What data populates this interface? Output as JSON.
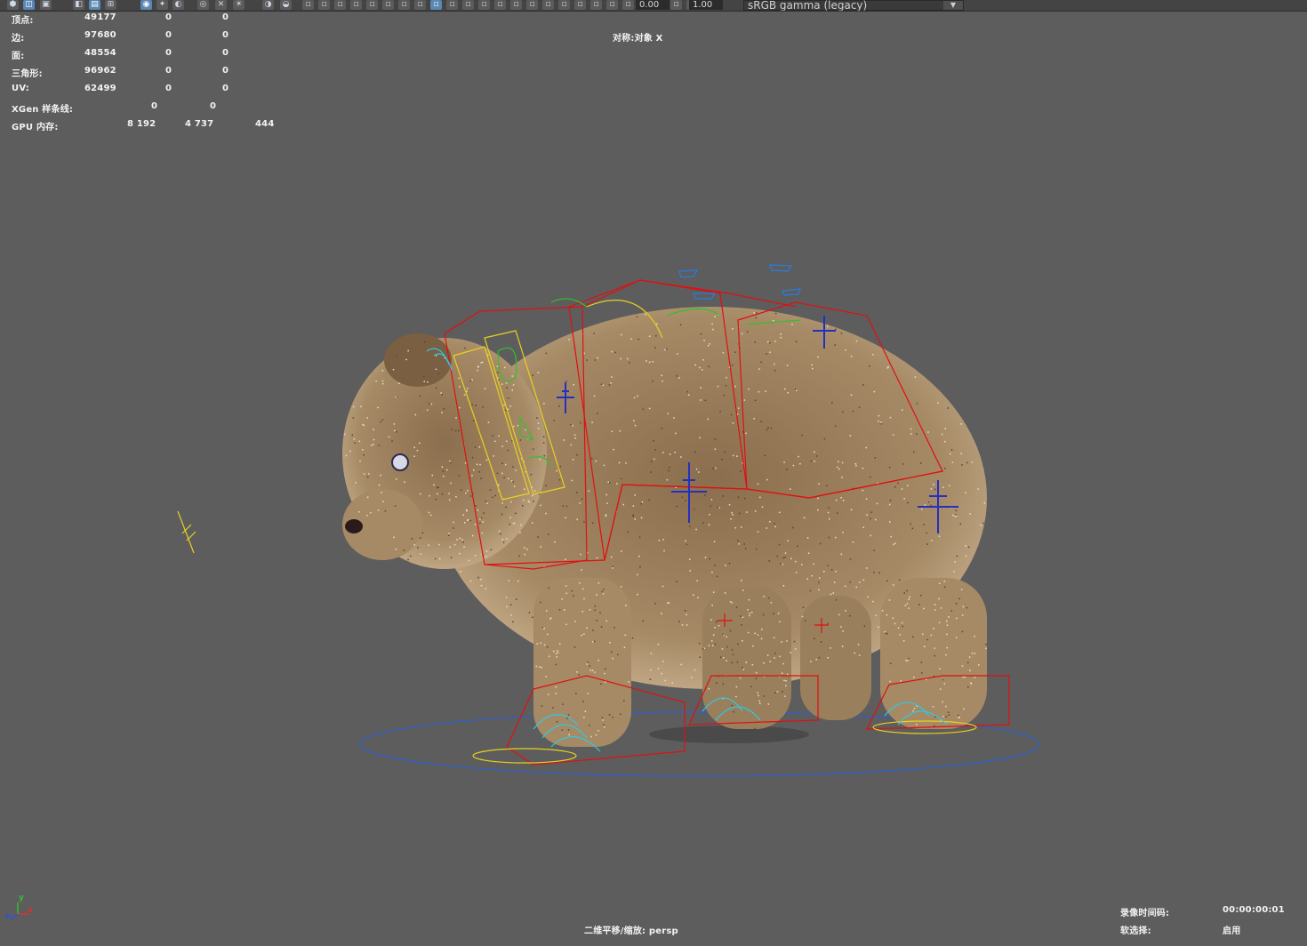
{
  "toolbar": {
    "exposure_value": "0.00",
    "gamma_value": "1.00",
    "color_space": "sRGB gamma (legacy)",
    "icons": [
      "camera-icon",
      "grid-icon",
      "film-gate-icon",
      "resolution-gate-icon",
      "wireframe-icon",
      "smooth-shade-icon",
      "textured-icon",
      "lights-icon",
      "shadows-icon",
      "isolate-select-icon",
      "xray-icon",
      "exposure-icon",
      "gamma-icon",
      "color-management-icon"
    ]
  },
  "hud_stats": {
    "rows": [
      {
        "label": "顶点:",
        "values": [
          "49177",
          "0",
          "0"
        ]
      },
      {
        "label": "边:",
        "values": [
          "97680",
          "0",
          "0"
        ]
      },
      {
        "label": "面:",
        "values": [
          "48554",
          "0",
          "0"
        ]
      },
      {
        "label": "三角形:",
        "values": [
          "96962",
          "0",
          "0"
        ]
      },
      {
        "label": "UV:",
        "values": [
          "62499",
          "0",
          "0"
        ]
      },
      {
        "label": "XGen 样条线:",
        "values": [
          "0",
          "0"
        ]
      },
      {
        "label": "GPU 内存:",
        "values": [
          "8 192",
          "4 737",
          "444"
        ]
      }
    ]
  },
  "symmetry_label": "对称:对象 X",
  "camera_label": "二维平移/缩放: persp",
  "timecode": {
    "label": "录像时间码:",
    "value": "00:00:00:01"
  },
  "soft_select": {
    "label": "软选择:",
    "value": "启用"
  },
  "axis_indicator": {
    "x": "x",
    "y": "y",
    "z": "z"
  },
  "colors": {
    "viewport_bg": "#5d5d5d",
    "fur": "#a08562",
    "rig_red": "#e01010",
    "rig_yellow": "#e8d020",
    "rig_blue": "#2430c0",
    "ground_circle": "#2b5fd0"
  }
}
